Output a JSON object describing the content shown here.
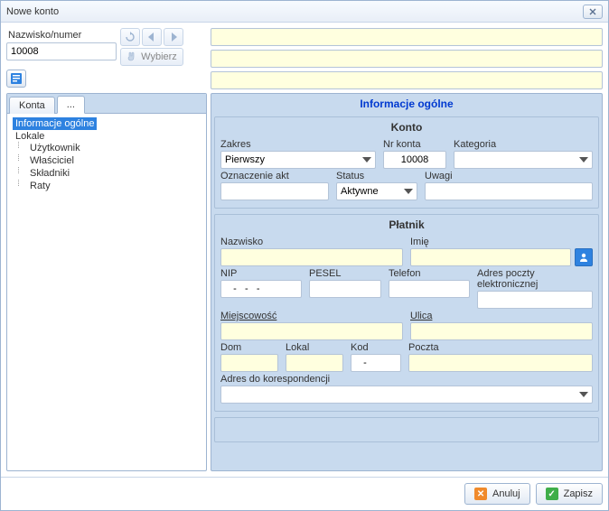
{
  "window": {
    "title": "Nowe konto"
  },
  "left": {
    "id_label": "Nazwisko/numer",
    "id_value": "10008",
    "wybierz_label": "Wybierz",
    "tabs": [
      {
        "label": "Konta",
        "active": false
      },
      {
        "label": "...",
        "active": true
      }
    ],
    "tree": [
      {
        "label": "Informacje ogólne",
        "selected": true
      },
      {
        "label": "Lokale",
        "children": [
          {
            "label": "Użytkownik"
          },
          {
            "label": "Właściciel"
          },
          {
            "label": "Składniki"
          },
          {
            "label": "Raty"
          }
        ]
      }
    ]
  },
  "top_inputs": [
    "",
    "",
    ""
  ],
  "main": {
    "header": "Informacje ogólne",
    "konto": {
      "title": "Konto",
      "zakres_label": "Zakres",
      "zakres_value": "Pierwszy",
      "nrkonta_label": "Nr konta",
      "nrkonta_value": "10008",
      "kategoria_label": "Kategoria",
      "kategoria_value": "",
      "oznaczenie_label": "Oznaczenie akt",
      "oznaczenie_value": "",
      "status_label": "Status",
      "status_value": "Aktywne",
      "uwagi_label": "Uwagi",
      "uwagi_value": ""
    },
    "platnik": {
      "title": "Płatnik",
      "nazwisko_label": "Nazwisko",
      "nazwisko_value": "",
      "imie_label": "Imię",
      "imie_value": "",
      "nip_label": "NIP",
      "nip_value": "   -   -   -",
      "pesel_label": "PESEL",
      "pesel_value": "",
      "telefon_label": "Telefon",
      "telefon_value": "",
      "email_label": "Adres poczty elektronicznej",
      "email_value": "",
      "miejscowosc_label": "Miejscowość",
      "miejscowosc_value": "",
      "ulica_label": "Ulica",
      "ulica_value": "",
      "dom_label": "Dom",
      "dom_value": "",
      "lokal_label": "Lokal",
      "lokal_value": "",
      "kod_label": "Kod",
      "kod_value": "   -",
      "poczta_label": "Poczta",
      "poczta_value": "",
      "koresp_label": "Adres do korespondencji",
      "koresp_value": ""
    }
  },
  "footer": {
    "anuluj": "Anuluj",
    "zapisz": "Zapisz"
  }
}
